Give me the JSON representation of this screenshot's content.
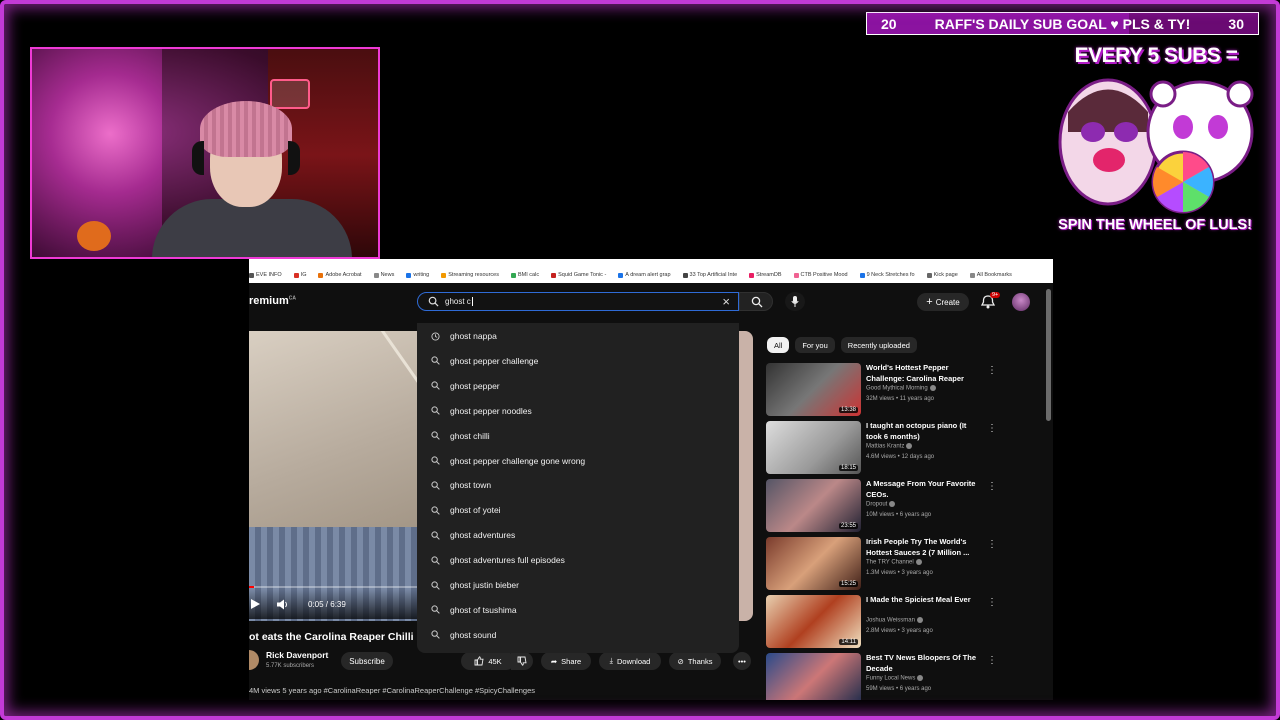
{
  "overlay": {
    "sub_goal": {
      "current": "20",
      "label": "RAFF'S DAILY SUB GOAL ♥ PLS & TY!",
      "target": "30",
      "progress": 0.67
    },
    "wheel_title": "EVERY 5 SUBS =",
    "wheel_caption": "SPIN THE WHEEL OF LULS!"
  },
  "browser": {
    "logo": "remium",
    "logo_region": "CA",
    "search_value": "ghost c",
    "create_label": "Create",
    "notif_count": "9+",
    "suggestions": [
      "ghost nappa",
      "ghost pepper challenge",
      "ghost pepper",
      "ghost pepper noodles",
      "ghost chilli",
      "ghost pepper challenge gone wrong",
      "ghost town",
      "ghost of yotei",
      "ghost adventures",
      "ghost adventures full episodes",
      "ghost justin bieber",
      "ghost of tsushima",
      "ghost sound"
    ],
    "bookmarks": [
      "EVE INFO",
      "IG",
      "Adobe Acrobat",
      "News",
      "writing",
      "Streaming resources",
      "BMI calc",
      "Squid Game Tonic -",
      "A dream alert grap",
      "33 Top Artificial Inte",
      "StreamDB",
      "CTB Positive Mood",
      "9 Neck Stretches fo",
      "Kick page",
      "All Bookmarks"
    ]
  },
  "video": {
    "time": "0:05 / 6:39",
    "title": "ot eats the Carolina Reaper Chilli",
    "channel": "Rick Davenport",
    "subs": "5.77K subscribers",
    "subscribe_label": "Subscribe",
    "likes": "45K",
    "share_label": "Share",
    "download_label": "Download",
    "thanks_label": "Thanks",
    "meta": "4M views  5 years ago  #CarolinaReaper #CarolinaReaperChallenge #SpicyChallenges"
  },
  "recs": {
    "chips": [
      "All",
      "For you",
      "Recently uploaded"
    ],
    "items": [
      {
        "title": "World's Hottest Pepper Challenge: Carolina Reaper",
        "channel": "Good Mythical Morning",
        "views": "32M views • 11 years ago",
        "duration": "13:38"
      },
      {
        "title": "I taught an octopus piano (It took 6 months)",
        "channel": "Mattias Krantz",
        "views": "4.6M views • 12 days ago",
        "duration": "18:15"
      },
      {
        "title": "A Message From Your Favorite CEOs.",
        "channel": "Dropout",
        "views": "10M views • 6 years ago",
        "duration": "23:55"
      },
      {
        "title": "Irish People Try The World's Hottest Sauces 2 (7 Million ...",
        "channel": "The TRY Channel",
        "views": "1.3M views • 3 years ago",
        "duration": "15:25"
      },
      {
        "title": "I Made the Spiciest Meal Ever",
        "channel": "Joshua Weissman",
        "views": "2.8M views • 3 years ago",
        "duration": "14:11"
      },
      {
        "title": "Best TV News Bloopers Of The Decade",
        "channel": "Funny Local News",
        "views": "59M views • 6 years ago",
        "duration": ""
      }
    ]
  }
}
